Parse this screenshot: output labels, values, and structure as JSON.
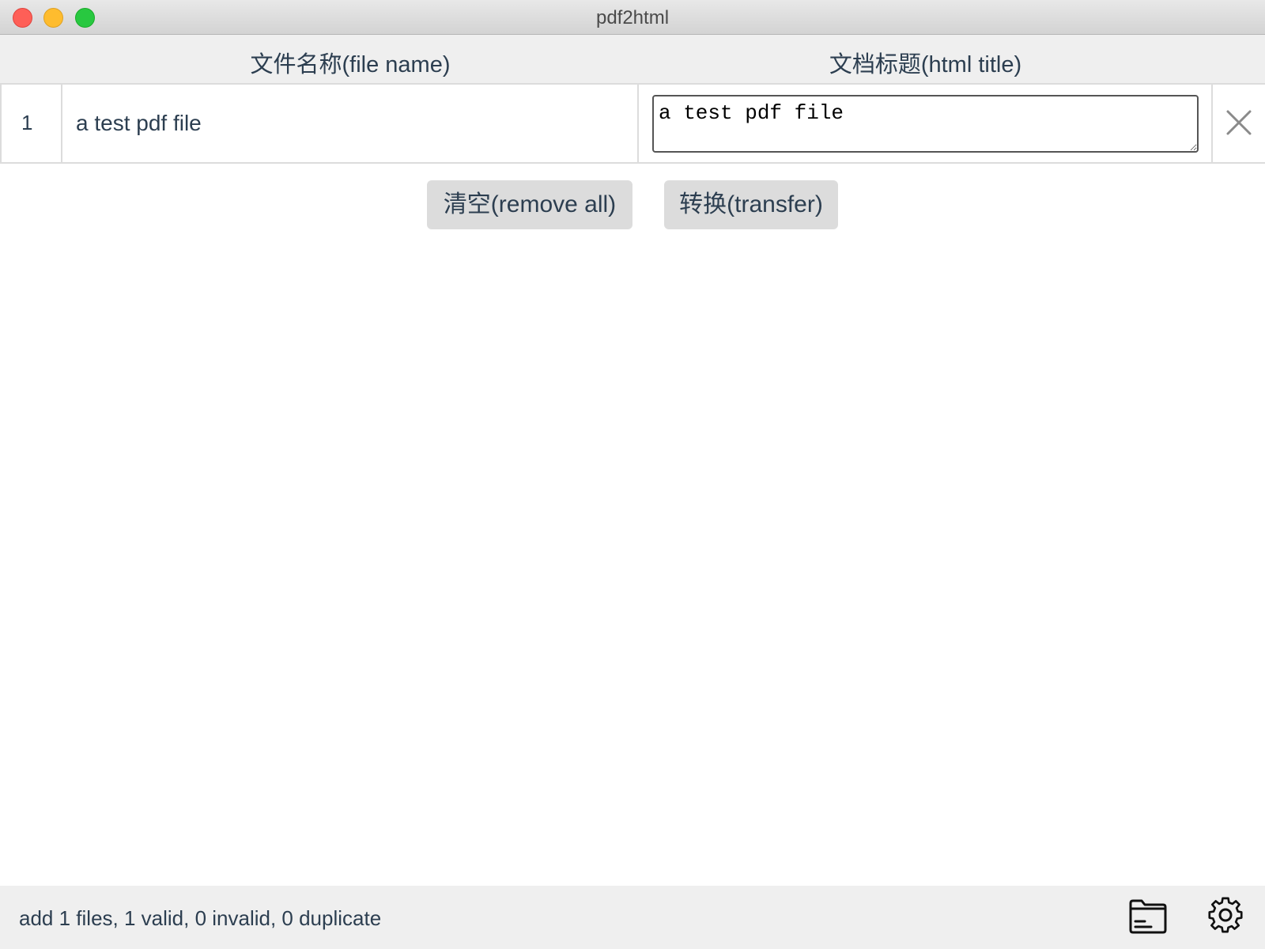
{
  "window": {
    "title": "pdf2html"
  },
  "table": {
    "columns": {
      "filename": "文件名称(file name)",
      "title": "文档标题(html title)"
    },
    "rows": [
      {
        "index": "1",
        "filename": "a test pdf file",
        "title": "a test pdf file",
        "delete_icon": "close-icon"
      }
    ]
  },
  "actions": {
    "clear_label": "清空(remove all)",
    "transfer_label": "转换(transfer)"
  },
  "status": {
    "text": "add 1 files, 1 valid, 0 invalid, 0 duplicate",
    "icons": [
      "folder-icon",
      "gear-icon"
    ]
  }
}
